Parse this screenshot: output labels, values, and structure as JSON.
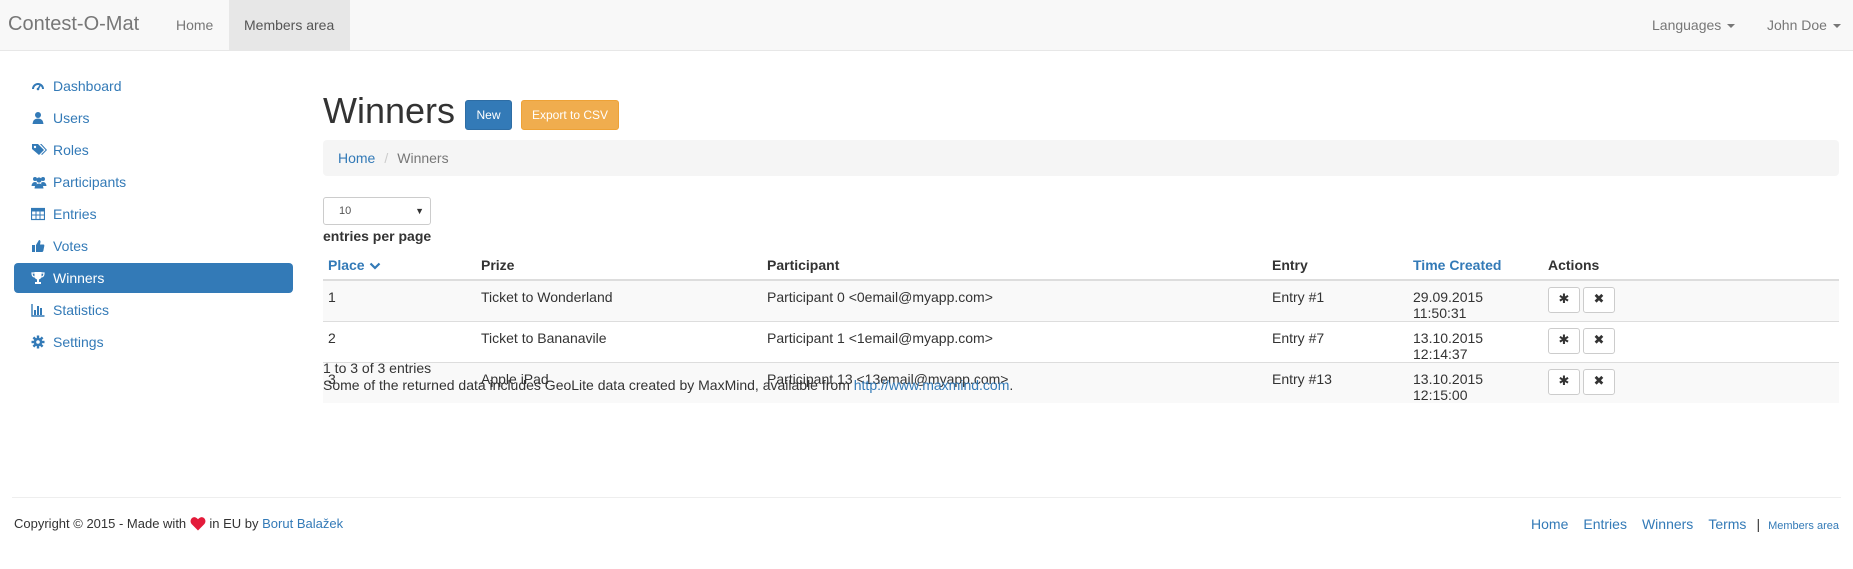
{
  "navbar": {
    "brand": "Contest-O-Mat",
    "links": [
      "Home",
      "Members area"
    ],
    "languages": "Languages",
    "user": "John Doe"
  },
  "sidebar": {
    "items": [
      {
        "label": "Dashboard",
        "icon": "dashboard-icon"
      },
      {
        "label": "Users",
        "icon": "user-icon"
      },
      {
        "label": "Roles",
        "icon": "tags-icon"
      },
      {
        "label": "Participants",
        "icon": "users-icon"
      },
      {
        "label": "Entries",
        "icon": "table-icon"
      },
      {
        "label": "Votes",
        "icon": "thumbs-up-icon"
      },
      {
        "label": "Winners",
        "icon": "trophy-icon",
        "active": true
      },
      {
        "label": "Statistics",
        "icon": "bar-chart-icon"
      },
      {
        "label": "Settings",
        "icon": "gear-icon"
      }
    ]
  },
  "page": {
    "title": "Winners",
    "new_label": "New",
    "export_label": "Export to CSV"
  },
  "breadcrumb": {
    "home": "Home",
    "current": "Winners"
  },
  "table": {
    "page_length": "10",
    "length_label": "entries per page",
    "columns": [
      "Place",
      "Prize",
      "Participant",
      "Entry",
      "Time Created",
      "Actions"
    ],
    "rows": [
      {
        "place": "1",
        "prize": "Ticket to Wonderland",
        "participant": "Participant 0 <0email@myapp.com>",
        "entry": "Entry #1",
        "time": "29.09.2015 11:50:31"
      },
      {
        "place": "2",
        "prize": "Ticket to Bananavile",
        "participant": "Participant 1 <1email@myapp.com>",
        "entry": "Entry #7",
        "time": "13.10.2015 12:14:37"
      },
      {
        "place": "3",
        "prize": "Apple iPad",
        "participant": "Participant 13 <13email@myapp.com>",
        "entry": "Entry #13",
        "time": "13.10.2015 12:15:00"
      }
    ],
    "info": "1 to 3 of 3 entries",
    "geolite_prefix": "Some of the returned data includes GeoLite data created by MaxMind, available from ",
    "geolite_link": "http://www.maxmind.com",
    "geolite_suffix": "."
  },
  "footer": {
    "copyright_prefix": "Copyright © 2015 - Made with ",
    "copyright_middle": " in EU by ",
    "author": "Borut Balažek",
    "links": [
      "Home",
      "Entries",
      "Winners",
      "Terms"
    ],
    "separator": "|",
    "members_link": "Members area"
  },
  "colors": {
    "primary": "#337ab7",
    "warning": "#f0ad4e",
    "heart": "#e31b3a"
  }
}
